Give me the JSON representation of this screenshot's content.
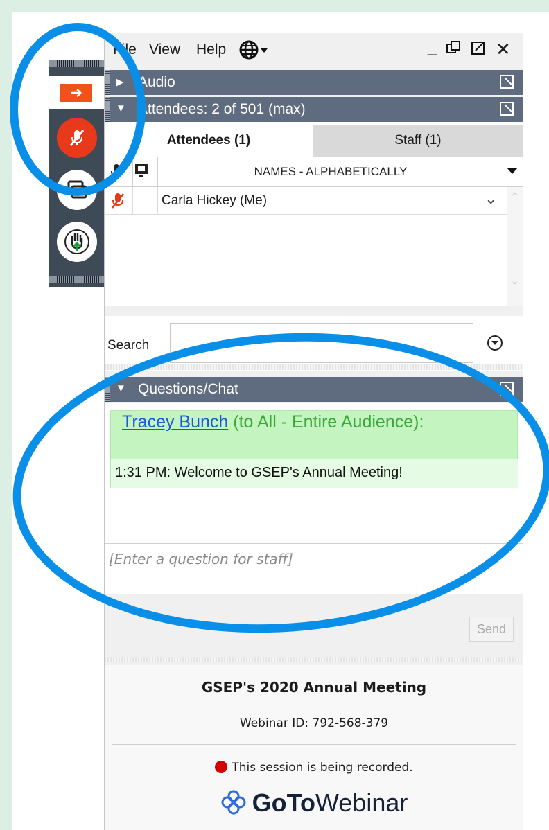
{
  "menu": {
    "file": "File",
    "view": "View",
    "help": "Help",
    "minimize": "_",
    "close": "✕"
  },
  "sections": {
    "audio": "Audio",
    "attendees": "Attendees:  2 of 501 (max)",
    "questions": "Questions/Chat"
  },
  "tabs": {
    "attendees": "Attendees (1)",
    "staff": "Staff (1)"
  },
  "list": {
    "header": "NAMES - ALPHABETICALLY",
    "rows": [
      {
        "name": "Carla Hickey (Me)"
      }
    ]
  },
  "search": {
    "label": "Search",
    "value": ""
  },
  "chat": {
    "sender": "Tracey Bunch",
    "recipient": " (to All - Entire Audience):",
    "time": "1:31 PM:",
    "message": "Welcome to GSEP's Annual Meeting!"
  },
  "question_input": {
    "placeholder": "[Enter a question for staff]"
  },
  "send_label": "Send",
  "footer": {
    "title": "GSEP's 2020 Annual Meeting",
    "webinar_id": "Webinar ID: 792-568-379",
    "recording": "This session is being recorded.",
    "brand_bold": "GoTo",
    "brand_regular": "Webinar"
  },
  "colors": {
    "accent_orange": "#f2511c",
    "mic_red": "#e8391a",
    "header_gray": "#5f6c80",
    "chat_green": "#c4f5c0",
    "annotation_blue": "#0a8fe8"
  }
}
